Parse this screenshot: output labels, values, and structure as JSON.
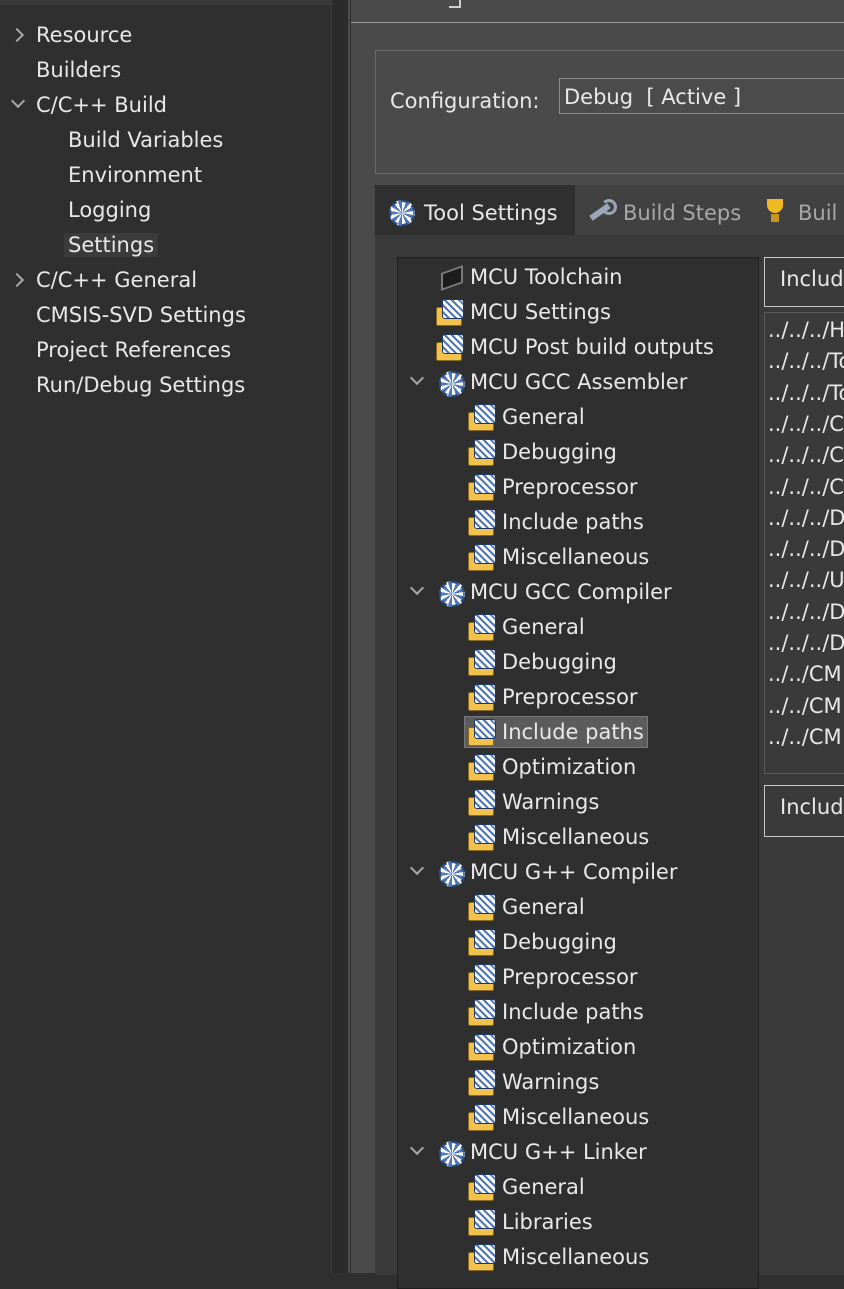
{
  "left_nav": {
    "items": [
      {
        "label": "Resource",
        "chevron": "right",
        "indent": 0,
        "selected": false
      },
      {
        "label": "Builders",
        "chevron": "",
        "indent": 0,
        "selected": false
      },
      {
        "label": "C/C++ Build",
        "chevron": "down",
        "indent": 0,
        "selected": false
      },
      {
        "label": "Build Variables",
        "chevron": "",
        "indent": 1,
        "selected": false
      },
      {
        "label": "Environment",
        "chevron": "",
        "indent": 1,
        "selected": false
      },
      {
        "label": "Logging",
        "chevron": "",
        "indent": 1,
        "selected": false
      },
      {
        "label": "Settings",
        "chevron": "",
        "indent": 1,
        "selected": true
      },
      {
        "label": "C/C++ General",
        "chevron": "right",
        "indent": 0,
        "selected": false
      },
      {
        "label": "CMSIS-SVD Settings",
        "chevron": "",
        "indent": 0,
        "selected": false
      },
      {
        "label": "Project References",
        "chevron": "",
        "indent": 0,
        "selected": false
      },
      {
        "label": "Run/Debug Settings",
        "chevron": "",
        "indent": 0,
        "selected": false
      }
    ]
  },
  "configuration": {
    "label": "Configuration:",
    "value": "Debug  [ Active ]"
  },
  "tabs": [
    {
      "label": "Tool Settings",
      "icon": "gear-icon",
      "active": true
    },
    {
      "label": "Build Steps",
      "icon": "wrench-icon",
      "active": false
    },
    {
      "label": "Buil",
      "icon": "trophy-icon",
      "active": false
    }
  ],
  "tree": {
    "items": [
      {
        "label": "MCU Toolchain",
        "icon": "chip-icon",
        "level": 0,
        "chevron": ""
      },
      {
        "label": "MCU Settings",
        "icon": "folder-icon",
        "level": 0,
        "chevron": ""
      },
      {
        "label": "MCU Post build outputs",
        "icon": "folder-icon",
        "level": 0,
        "chevron": ""
      },
      {
        "label": "MCU GCC Assembler",
        "icon": "gear-icon",
        "level": 0,
        "chevron": "down"
      },
      {
        "label": "General",
        "icon": "folder-icon",
        "level": 1,
        "chevron": ""
      },
      {
        "label": "Debugging",
        "icon": "folder-icon",
        "level": 1,
        "chevron": ""
      },
      {
        "label": "Preprocessor",
        "icon": "folder-icon",
        "level": 1,
        "chevron": ""
      },
      {
        "label": "Include paths",
        "icon": "folder-icon",
        "level": 1,
        "chevron": ""
      },
      {
        "label": "Miscellaneous",
        "icon": "folder-icon",
        "level": 1,
        "chevron": ""
      },
      {
        "label": "MCU GCC Compiler",
        "icon": "gear-icon",
        "level": 0,
        "chevron": "down"
      },
      {
        "label": "General",
        "icon": "folder-icon",
        "level": 1,
        "chevron": ""
      },
      {
        "label": "Debugging",
        "icon": "folder-icon",
        "level": 1,
        "chevron": ""
      },
      {
        "label": "Preprocessor",
        "icon": "folder-icon",
        "level": 1,
        "chevron": ""
      },
      {
        "label": "Include paths",
        "icon": "folder-icon",
        "level": 1,
        "chevron": "",
        "selected": true
      },
      {
        "label": "Optimization",
        "icon": "folder-icon",
        "level": 1,
        "chevron": ""
      },
      {
        "label": "Warnings",
        "icon": "folder-icon",
        "level": 1,
        "chevron": ""
      },
      {
        "label": "Miscellaneous",
        "icon": "folder-icon",
        "level": 1,
        "chevron": ""
      },
      {
        "label": "MCU G++ Compiler",
        "icon": "gear-icon",
        "level": 0,
        "chevron": "down"
      },
      {
        "label": "General",
        "icon": "folder-icon",
        "level": 1,
        "chevron": ""
      },
      {
        "label": "Debugging",
        "icon": "folder-icon",
        "level": 1,
        "chevron": ""
      },
      {
        "label": "Preprocessor",
        "icon": "folder-icon",
        "level": 1,
        "chevron": ""
      },
      {
        "label": "Include paths",
        "icon": "folder-icon",
        "level": 1,
        "chevron": ""
      },
      {
        "label": "Optimization",
        "icon": "folder-icon",
        "level": 1,
        "chevron": ""
      },
      {
        "label": "Warnings",
        "icon": "folder-icon",
        "level": 1,
        "chevron": ""
      },
      {
        "label": "Miscellaneous",
        "icon": "folder-icon",
        "level": 1,
        "chevron": ""
      },
      {
        "label": "MCU G++ Linker",
        "icon": "gear-icon",
        "level": 0,
        "chevron": "down"
      },
      {
        "label": "General",
        "icon": "folder-icon",
        "level": 1,
        "chevron": ""
      },
      {
        "label": "Libraries",
        "icon": "folder-icon",
        "level": 1,
        "chevron": ""
      },
      {
        "label": "Miscellaneous",
        "icon": "folder-icon",
        "level": 1,
        "chevron": ""
      }
    ]
  },
  "include_panel": {
    "header": "Includ",
    "paths": [
      "../../../H",
      "../../../To",
      "../../../To",
      "../../../Cl",
      "../../../Cl",
      "../../../Cl",
      "../../../Dr",
      "../../../Dr",
      "../../../Ut",
      "../../../Dr",
      "../../../Dr",
      "../../CM",
      "../../CM",
      "../../CM"
    ],
    "footer": "Includ"
  },
  "colors": {
    "background": "#2f2f2f",
    "content_background": "#4a4a4a",
    "selection": "#5c5c5c",
    "text": "#e8e8e8"
  }
}
